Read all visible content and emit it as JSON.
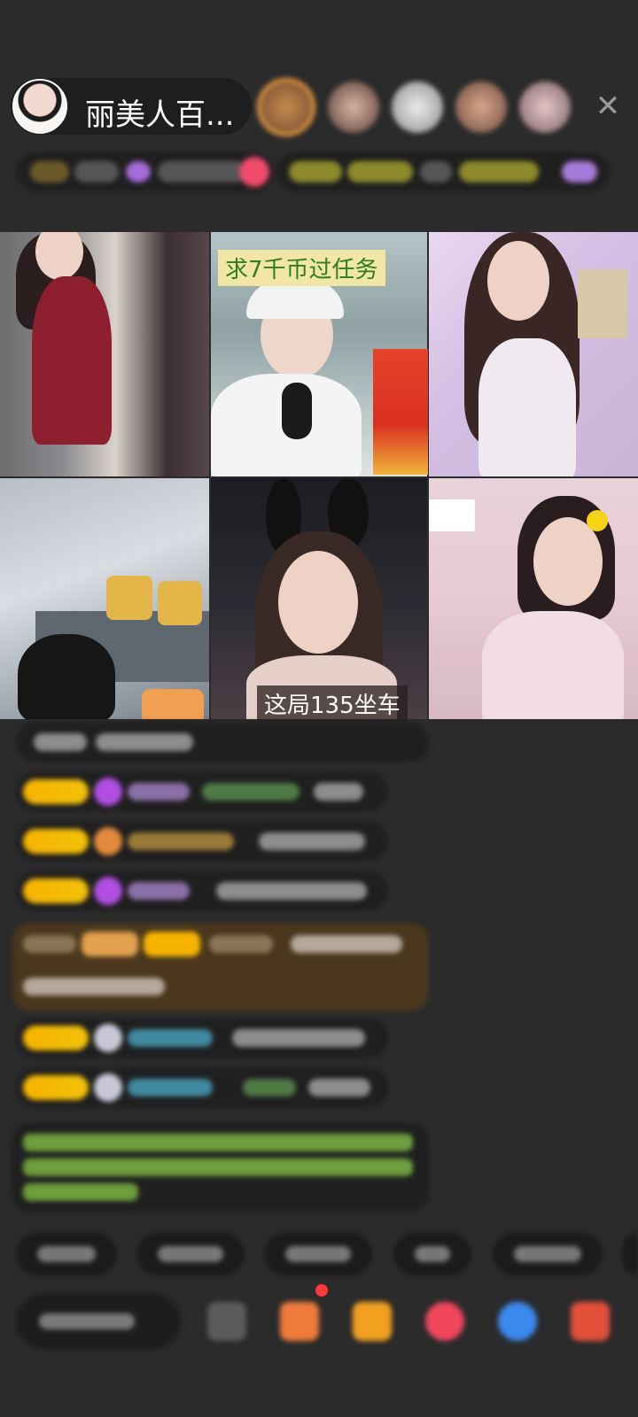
{
  "header": {
    "host_name": "丽美人百...",
    "close_icon": "close-icon"
  },
  "video_grid": {
    "tile2_caption": "求7千币过任务",
    "tile5_caption": "这局135坐车"
  },
  "colors": {
    "background": "#2b2b2c",
    "badge_gold": "#f6b400",
    "caption_green": "#2f7d1d",
    "system_msg_green": "#6d9e3b"
  }
}
